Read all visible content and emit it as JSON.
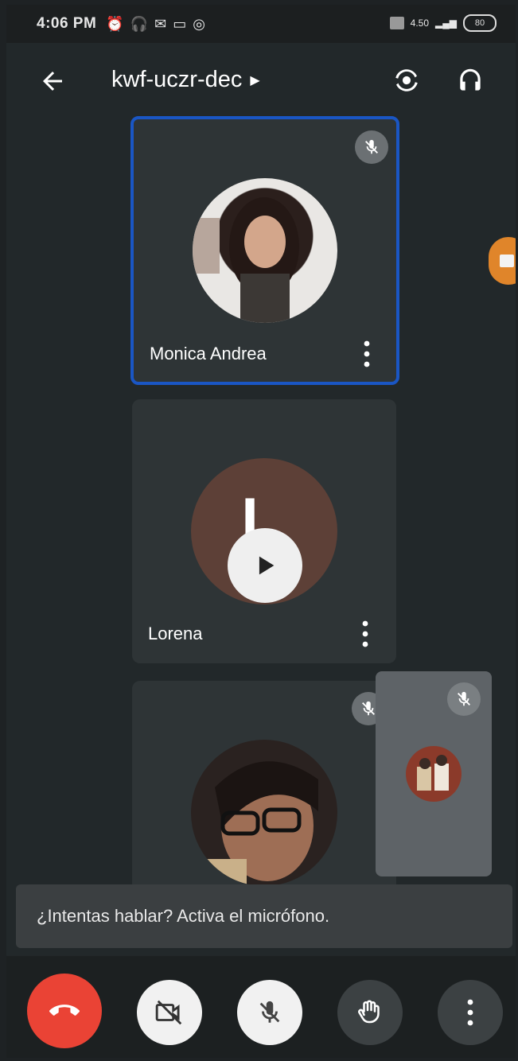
{
  "status_bar": {
    "time": "4:06 PM",
    "signal_text": "4.50",
    "battery_text": "80"
  },
  "header": {
    "title": "kwf-uczr-dec"
  },
  "participants": [
    {
      "name": "Monica Andrea",
      "muted": true,
      "active_speaker": true
    },
    {
      "name": "Lorena",
      "initial": "L",
      "avatar_color": "#5d4037"
    },
    {
      "name": "",
      "muted": true
    }
  ],
  "toast": {
    "message": "¿Intentas hablar? Activa el micrófono."
  },
  "colors": {
    "end_call": "#ea4335",
    "active_border": "#1a56c4",
    "tile_bg": "#2e3436"
  },
  "icons": {
    "back": "arrow-left-icon",
    "switch_camera": "camera-switch-icon",
    "audio_output": "headphones-icon",
    "end_call": "phone-hangup-icon",
    "camera": "video-off-icon",
    "mic": "mic-off-icon",
    "hand": "raise-hand-icon",
    "more": "more-vertical-icon"
  }
}
